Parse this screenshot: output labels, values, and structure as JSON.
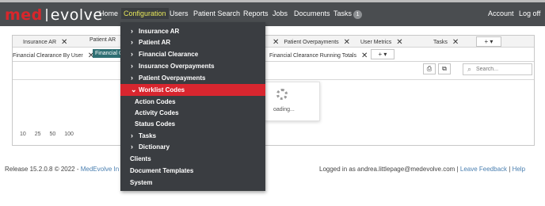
{
  "logo": {
    "part1": "med",
    "part2": "evolve"
  },
  "nav": {
    "home": "Home",
    "configuration": "Configuration",
    "users": "Users",
    "patient_search": "Patient Search",
    "reports": "Reports",
    "jobs": "Jobs",
    "documents": "Documents",
    "tasks": "Tasks",
    "tasks_count": "1",
    "account": "Account",
    "logoff": "Log off"
  },
  "tabs_row1": [
    {
      "label": "Insurance AR"
    },
    {
      "label": "Patient AR"
    },
    {
      "label": "Patient Overpayments"
    },
    {
      "label": "User Metrics"
    },
    {
      "label": "Tasks"
    }
  ],
  "tabs_row2": [
    {
      "label": "Financial Clearance By User"
    },
    {
      "label": "Financial C"
    },
    {
      "label": "Financial Clearance Running Totals"
    }
  ],
  "add_tab": "+ ▾",
  "search": {
    "placeholder": "Search..."
  },
  "loading_text": "oading...",
  "pager": [
    "10",
    "25",
    "50",
    "100"
  ],
  "footer": {
    "release": "Release 15.2.0.8 © 2022 - ",
    "company_link": "MedEvolve In",
    "logged_in": "Logged in as andrea.littlepage@medevolve.com | ",
    "feedback_link": "Leave Feedback",
    "sep": " | ",
    "help_link": "Help"
  },
  "dropdown": {
    "items": [
      {
        "label": "Insurance AR",
        "chev": "›"
      },
      {
        "label": "Patient AR",
        "chev": "›"
      },
      {
        "label": "Financial Clearance",
        "chev": "›"
      },
      {
        "label": "Insurance Overpayments",
        "chev": "›"
      },
      {
        "label": "Patient Overpayments",
        "chev": "›"
      },
      {
        "label": "Worklist Codes",
        "chev": "⌄"
      },
      {
        "label": "Action Codes",
        "chev": ""
      },
      {
        "label": "Activity Codes",
        "chev": ""
      },
      {
        "label": "Status Codes",
        "chev": ""
      },
      {
        "label": "Tasks",
        "chev": "›"
      },
      {
        "label": "Dictionary",
        "chev": "›"
      },
      {
        "label": "Clients",
        "chev": ""
      },
      {
        "label": "Document Templates",
        "chev": ""
      },
      {
        "label": "System",
        "chev": ""
      }
    ]
  },
  "colors": {
    "topbar": "#4a4d50",
    "accent_red": "#d8262f",
    "active_nav": "#e7e75a",
    "active_tab": "#2f6f73",
    "dropdown_bg": "#3a3d41"
  },
  "icons": {
    "export": "export-icon",
    "columns": "columns-icon",
    "search": "search-icon",
    "close": "close-icon",
    "chevron": "chevron-icon"
  }
}
